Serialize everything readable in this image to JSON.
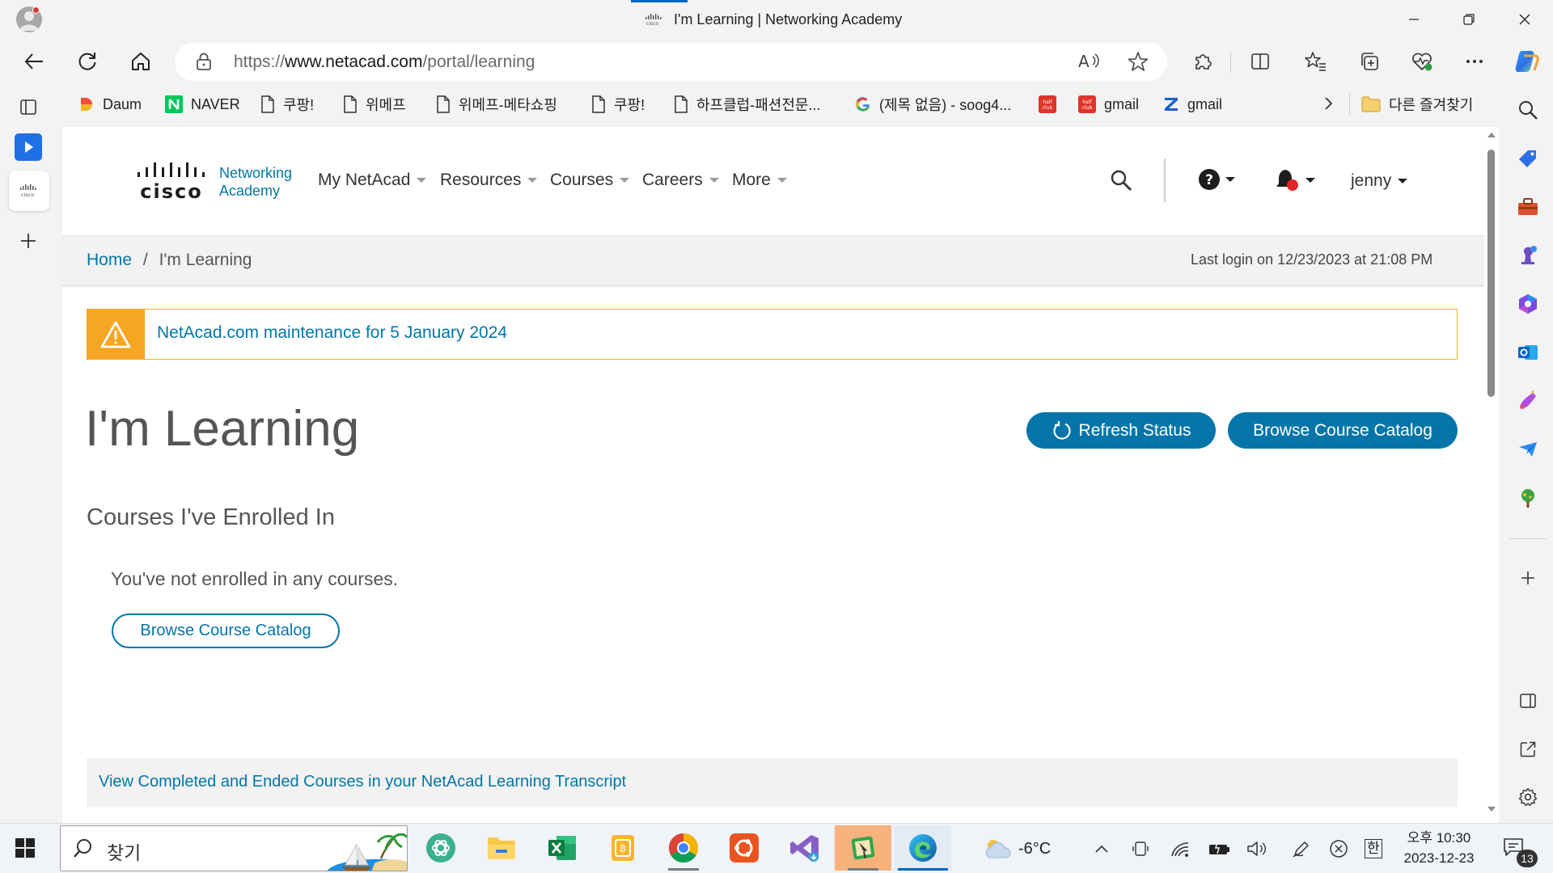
{
  "browser": {
    "tab_title": "I'm Learning | Networking Academy",
    "url_prefix": "https://",
    "url_domain": "www.netacad.com",
    "url_path": "/portal/learning",
    "favorites": [
      {
        "label": "Daum",
        "icon": "daum-icon"
      },
      {
        "label": "NAVER",
        "icon": "naver-icon"
      },
      {
        "label": "쿠팡!",
        "icon": "page-icon"
      },
      {
        "label": "위메프",
        "icon": "page-icon"
      },
      {
        "label": "위메프-메타쇼핑",
        "icon": "page-icon"
      },
      {
        "label": "쿠팡!",
        "icon": "page-icon"
      },
      {
        "label": "하프클럽-패션전문...",
        "icon": "page-icon"
      },
      {
        "label": "(제목 없음) - soog4...",
        "icon": "google-icon"
      },
      {
        "label": "",
        "icon": "halfclub-icon"
      },
      {
        "label": "gmail",
        "icon": "halfclub-icon"
      },
      {
        "label": "gmail",
        "icon": "zoho-icon"
      }
    ],
    "other_favorites": "다른 즐겨찾기"
  },
  "site": {
    "logo_wordmark": "cisco",
    "logo_line1": "Networking",
    "logo_line2": "Academy",
    "nav": [
      "My NetAcad",
      "Resources",
      "Courses",
      "Careers",
      "More"
    ],
    "user": "jenny",
    "breadcrumb_home": "Home",
    "breadcrumb_sep": "/",
    "breadcrumb_current": "I'm Learning",
    "last_login": "Last login on 12/23/2023 at 21:08 PM",
    "alert": "NetAcad.com maintenance for 5 January 2024",
    "page_title": "I'm Learning",
    "refresh_button": "Refresh Status",
    "catalog_button": "Browse Course Catalog",
    "section_title": "Courses I've Enrolled In",
    "empty_note": "You've not enrolled in any courses.",
    "catalog_link_button": "Browse Course Catalog",
    "transcript_link": "View Completed and Ended Courses in your NetAcad Learning Transcript"
  },
  "taskbar": {
    "search_placeholder": "찾기",
    "weather": "-6°C",
    "ime": "한",
    "time": "오후 10:30",
    "date": "2023-12-23",
    "notifications": "13"
  },
  "colors": {
    "brand": "#0475a8",
    "warning": "#f5a623",
    "edge_blue": "#0067c0"
  }
}
